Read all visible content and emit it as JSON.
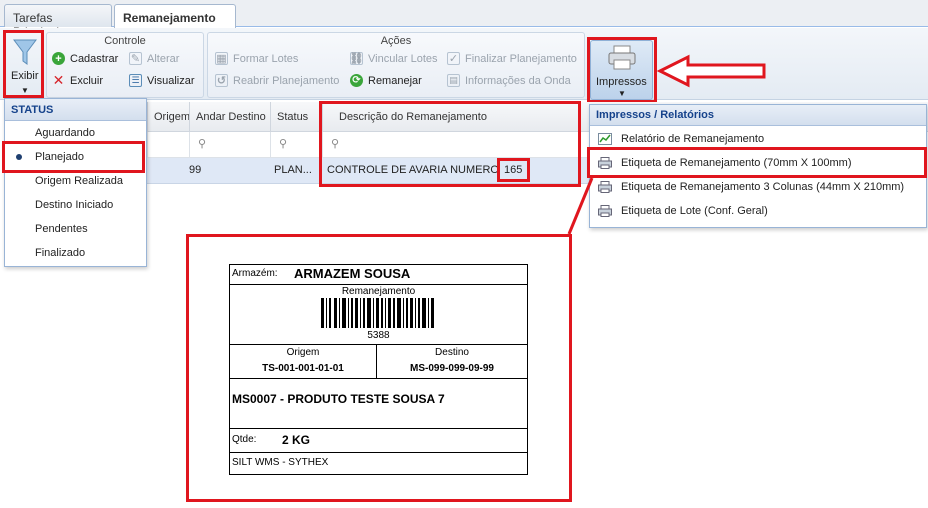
{
  "tabs": [
    {
      "label": "Tarefas Principais"
    },
    {
      "label": "Remanejamento",
      "close": "×"
    }
  ],
  "ribbon": {
    "exibir": "Exibir",
    "controle": {
      "title": "Controle",
      "cadastrar": "Cadastrar",
      "alterar": "Alterar",
      "excluir": "Excluir",
      "visualizar": "Visualizar"
    },
    "acoes": {
      "title": "Ações",
      "formar_lotes": "Formar Lotes",
      "vincular_lotes": "Vincular Lotes",
      "finalizar_planejamento": "Finalizar Planejamento",
      "reabrir_planejamento": "Reabrir Planejamento",
      "remanejar": "Remanejar",
      "informacoes_onda": "Informações da Onda"
    },
    "impressos": "Impressos"
  },
  "grid": {
    "headers": [
      "Origem",
      "Andar Destino",
      "Status",
      "Descrição do Remanejamento"
    ],
    "row": {
      "andar_destino": "99",
      "status": "PLAN...",
      "descricao": "CONTROLE DE AVARIA NUMERO",
      "numero": "165"
    }
  },
  "status_menu": {
    "title": "STATUS",
    "items": [
      "Aguardando",
      "Planejado",
      "Origem Realizada",
      "Destino Iniciado",
      "Pendentes",
      "Finalizado"
    ],
    "selected": "Planejado"
  },
  "reports_menu": {
    "title": "Impressos / Relatórios",
    "items": [
      "Relatório de Remanejamento",
      "Etiqueta de Remanejamento (70mm X 100mm)",
      "Etiqueta de Remanejamento 3 Colunas (44mm X 210mm)",
      "Etiqueta de Lote (Conf. Geral)"
    ]
  },
  "label": {
    "armazem_label": "Armazém:",
    "armazem_value": "ARMAZEM SOUSA",
    "barcode_title": "Remanejamento",
    "barcode_number": "5388",
    "origem_label": "Origem",
    "origem_value": "TS-001-001-01-01",
    "destino_label": "Destino",
    "destino_value": "MS-099-099-09-99",
    "produto": "MS0007 - PRODUTO TESTE SOUSA 7",
    "qtde_label": "Qtde:",
    "qtde_value": "2 KG",
    "footer": "SILT WMS - SYTHEX"
  },
  "colors": {
    "highlight": "#e0161e",
    "menu_title": "#15428b",
    "selected_row": "#dfe8f6"
  }
}
